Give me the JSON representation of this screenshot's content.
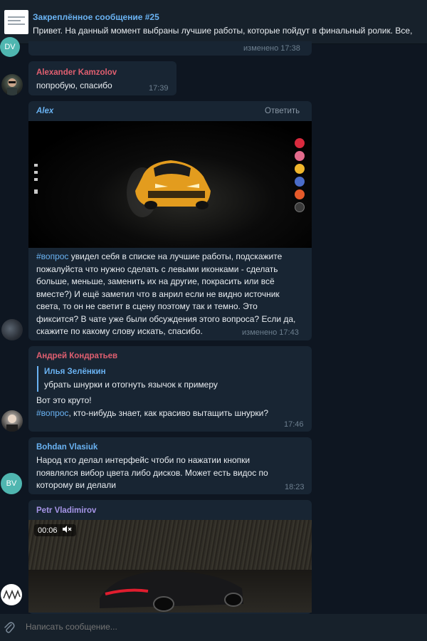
{
  "pinned": {
    "title": "Закреплённое сообщение #25",
    "text": "Привет. На данный момент выбраны лучшие работы, которые пойдут в финальный ролик. Все,"
  },
  "messages": [
    {
      "avatar_initials": "DV",
      "time": "изменено 17:38"
    },
    {
      "sender": "Alexander Kamzolov",
      "sender_color": "#e05f70",
      "text": "попробую, спасибо",
      "time": "17:39"
    },
    {
      "sender": "Alex",
      "sender_color": "#6ab3f3",
      "reply_label": "Ответить",
      "hashtag": "#вопрос",
      "lines": [
        " увидел себя в списке на лучшие работы, подскажите",
        "пожалуйста что нужно сделать с левыми иконками - сделать",
        "больше, меньше, заменить их на другие, покрасить или всё",
        "вместе?) И ещё заметил что в анрил если не видно источник",
        "света, то он не светит в сцену поэтому так и темно. Это",
        "фиксится? В чате уже были обсуждения этого вопроса? Если да,",
        "скажите по какому слову искать, спасибо."
      ],
      "time": "изменено 17:43",
      "swatch_colors": [
        "#d92a3e",
        "#e36b8c",
        "#f0b62c",
        "#4a6cc8",
        "#e65a2a",
        "#3a3a3a"
      ]
    },
    {
      "sender": "Андрей Кондратьев",
      "sender_color": "#e05f70",
      "quote_name": "Илья Зелёнкин",
      "quote_text": "убрать шнурки и отогнуть язычок к примеру",
      "line1": "Вот это круто!",
      "hashtag": "#вопрос",
      "line2": ", кто-нибудь знает, как красиво вытащить шнурки?",
      "time": "17:46"
    },
    {
      "sender": "Bohdan Vlasiuk",
      "sender_color": "#6ab3f3",
      "avatar_initials": "BV",
      "lines": [
        "Народ кто делал интерфейс чтоби по нажатии кнопки",
        "появлялся вибор цвета либо дисков.  Может есть видос по",
        "которому ви делали"
      ],
      "time": "18:23"
    },
    {
      "sender": "Petr Vladimirov",
      "sender_color": "#a695e7",
      "video_time": "00:06"
    }
  ],
  "compose": {
    "placeholder": "Написать сообщение..."
  }
}
